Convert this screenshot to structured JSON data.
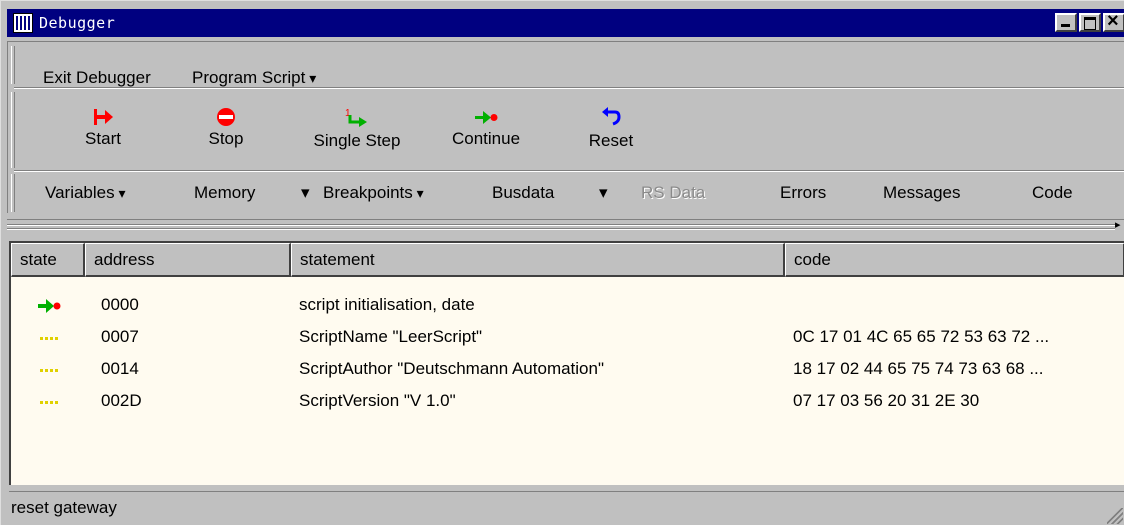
{
  "window": {
    "title": "Debugger",
    "title_bg": "#000080"
  },
  "menubar": {
    "exit_label": "Exit Debugger",
    "program_script_label": "Program Script"
  },
  "toolbar": {
    "start": {
      "label": "Start",
      "icon": "start-arrow-icon",
      "color": "#ff0000"
    },
    "stop": {
      "label": "Stop",
      "icon": "stop-icon",
      "color": "#ff0000"
    },
    "single_step": {
      "label": "Single Step",
      "icon": "single-step-icon"
    },
    "continue": {
      "label": "Continue",
      "icon": "continue-icon"
    },
    "reset": {
      "label": "Reset",
      "icon": "reset-icon",
      "color": "#0000ff"
    }
  },
  "viewbar": {
    "variables": "Variables",
    "memory": "Memory",
    "breakpoints": "Breakpoints",
    "busdata": "Busdata",
    "rs_data": "RS Data",
    "errors": "Errors",
    "messages": "Messages",
    "code": "Code"
  },
  "table": {
    "columns": [
      "state",
      "address",
      "statement",
      "code"
    ],
    "rows": [
      {
        "state": "current",
        "address": "0000",
        "statement": "script initialisation, date",
        "code": ""
      },
      {
        "state": "pending",
        "address": "0007",
        "statement": "ScriptName \"LeerScript\"",
        "code": "0C 17 01 4C 65 65 72 53 63 72 ..."
      },
      {
        "state": "pending",
        "address": "0014",
        "statement": "ScriptAuthor \"Deutschmann Automation\"",
        "code": "18 17 02 44 65 75 74 73 63 68 ..."
      },
      {
        "state": "pending",
        "address": "002D",
        "statement": "ScriptVersion \"V 1.0\"",
        "code": "07 17 03 56 20 31 2E 30"
      }
    ],
    "background": "#fffbf0"
  },
  "status": {
    "text": "reset gateway"
  }
}
